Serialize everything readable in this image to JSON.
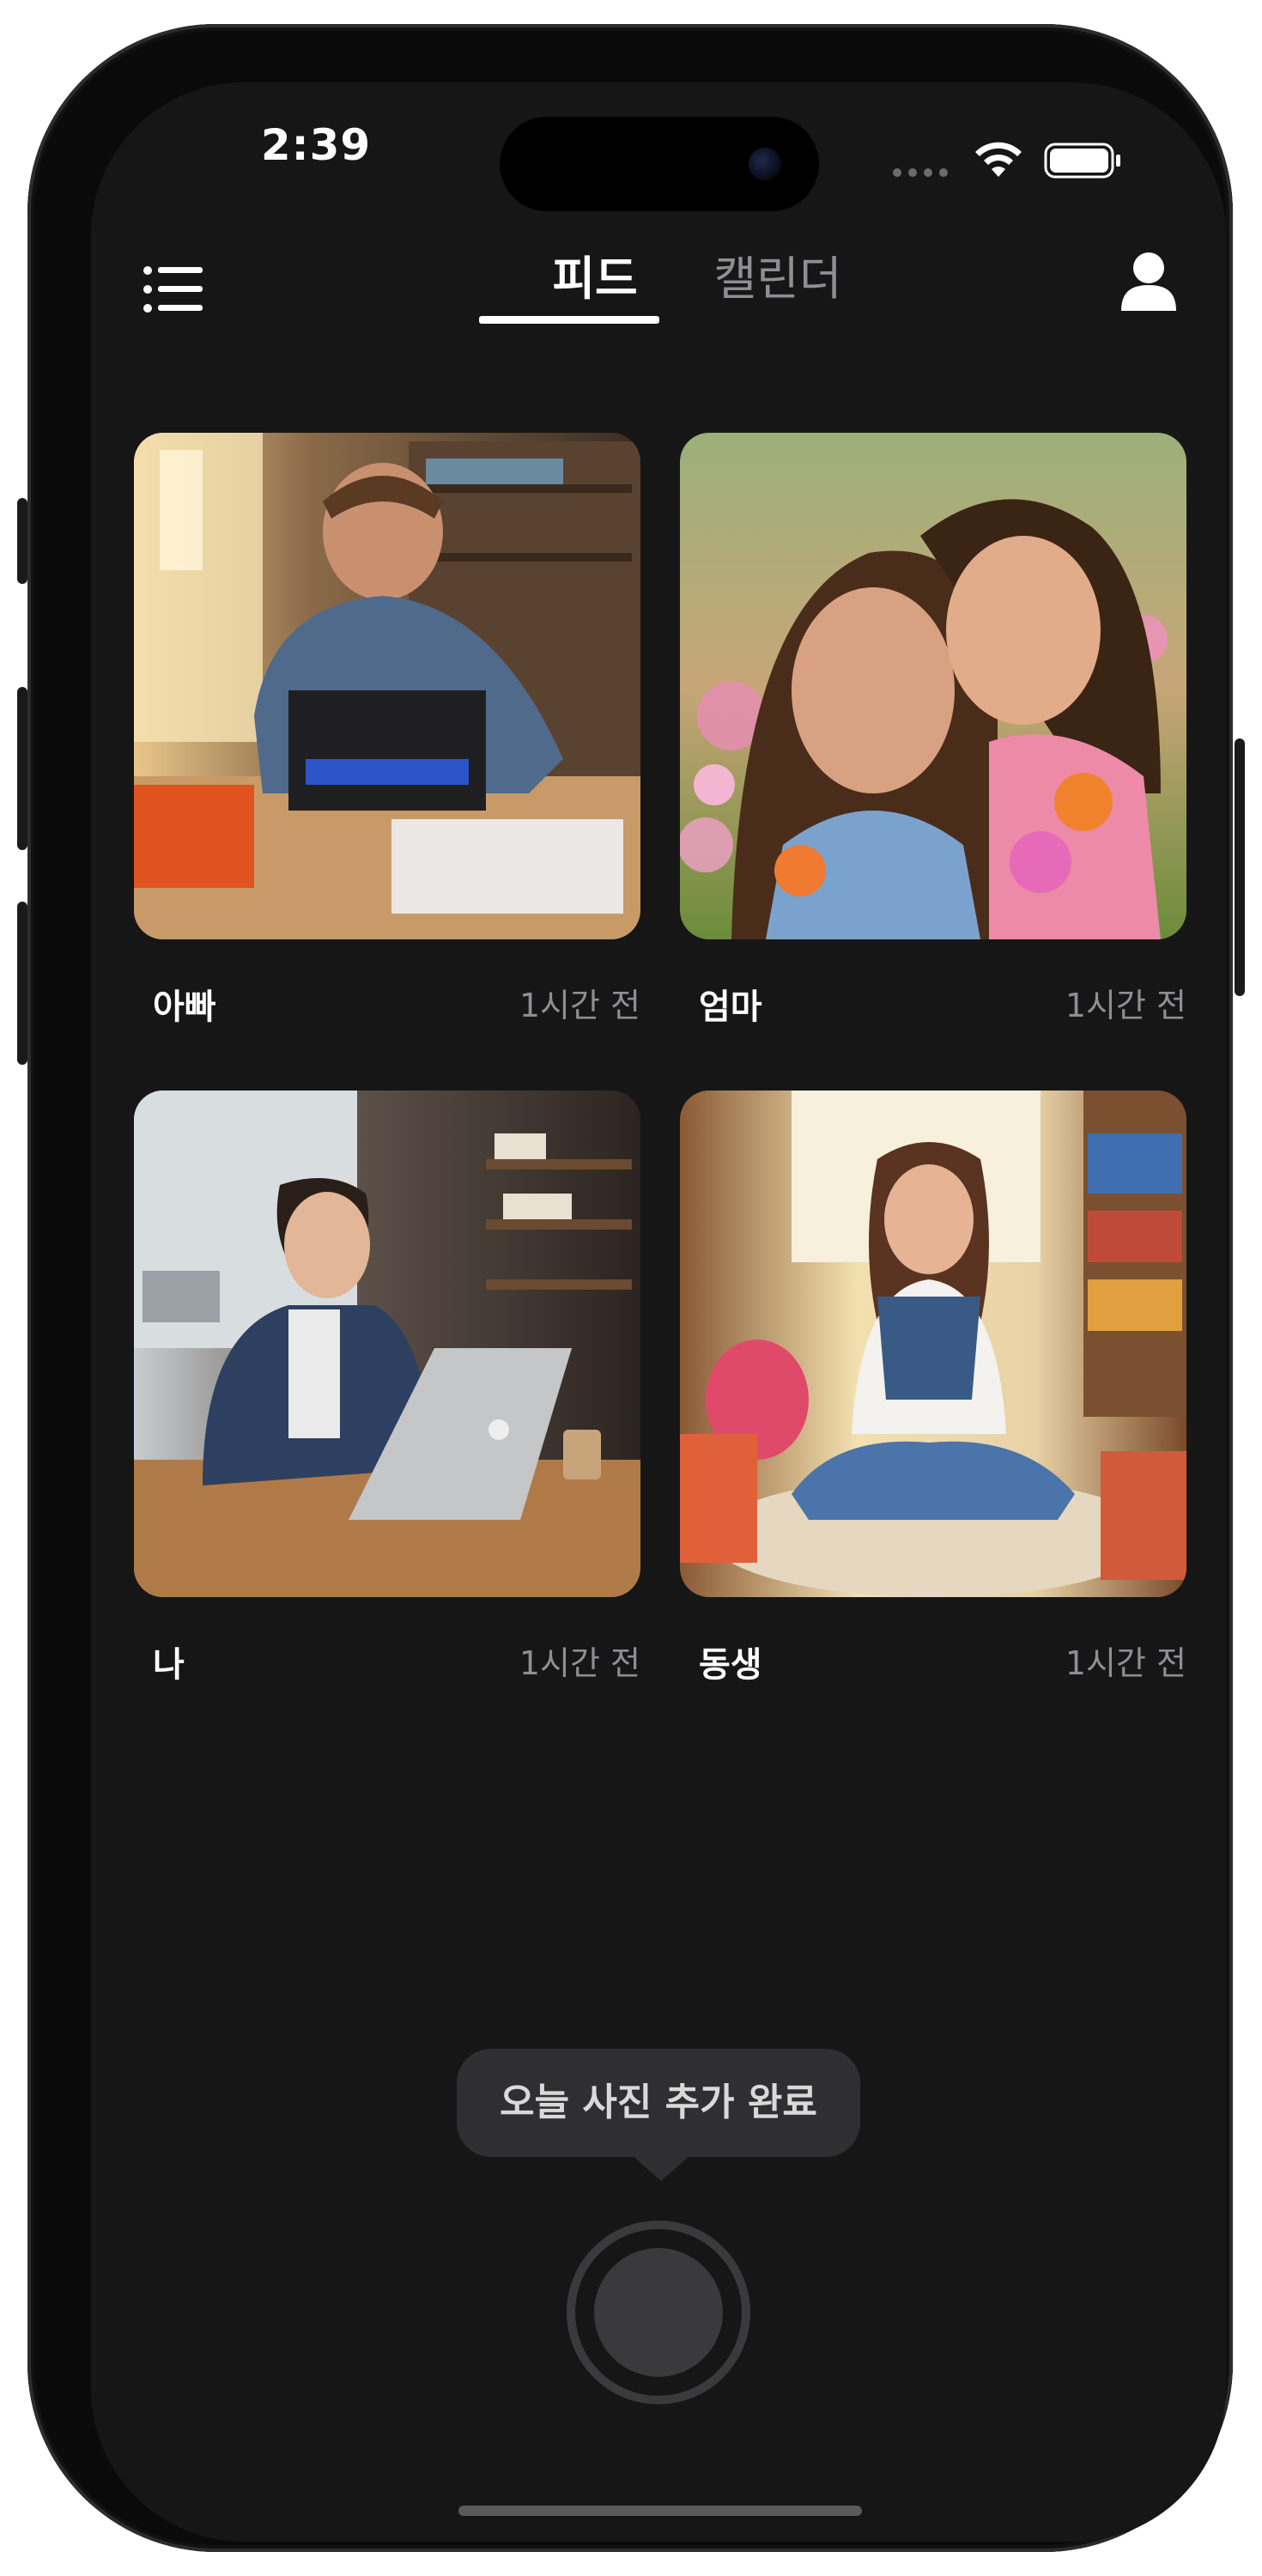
{
  "status_bar": {
    "time": "2:39"
  },
  "header": {
    "tabs": [
      {
        "label": "피드",
        "active": true
      },
      {
        "label": "캘린더",
        "active": false
      }
    ],
    "menu_icon": "list-icon",
    "profile_icon": "person-icon"
  },
  "feed": {
    "cards": [
      {
        "name": "아빠",
        "time": "1시간 전",
        "photo": "man-building-3d-printer-photo"
      },
      {
        "name": "엄마",
        "time": "1시간 전",
        "photo": "mother-daughter-flowers-photo"
      },
      {
        "name": "나",
        "time": "1시간 전",
        "photo": "young-man-laptop-cafe-photo"
      },
      {
        "name": "동생",
        "time": "1시간 전",
        "photo": "girl-sitting-library-photo"
      }
    ]
  },
  "toast": {
    "text": "오늘 사진 추가 완료"
  },
  "colors": {
    "background": "#161616",
    "text_primary": "#ffffff",
    "text_secondary": "#8e8e93",
    "toast_bg": "#2f2f31"
  }
}
